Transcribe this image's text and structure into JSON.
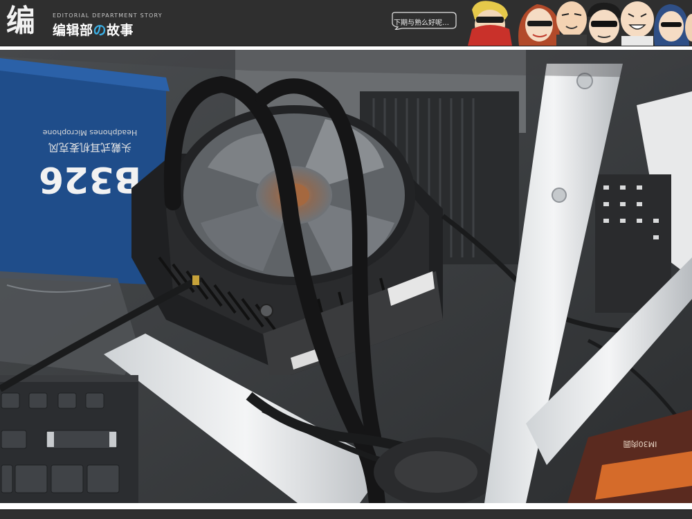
{
  "header": {
    "logo_mark": "编",
    "logo_subtitle": "EDITORIAL DEPARTMENT STORY",
    "logo_title_part1": "编辑部",
    "logo_title_accent": "の",
    "logo_title_part2": "故事",
    "speech_bubble": "下期与熟么好呢…",
    "avatars": [
      "bandit-avatar",
      "red-hair-girl-avatar",
      "bald-man-avatar",
      "sunglasses-man-avatar",
      "laughing-man-avatar",
      "blue-hair-girl-avatar",
      "partial-avatar"
    ]
  },
  "photo": {
    "box_label_model": "B326",
    "box_label_cn": "头戴式耳机麦克风",
    "box_label_en": "Headphones Microphone",
    "bottom_right_text": "IM30肉圆"
  },
  "colors": {
    "banner_bg": "#2f2f2f",
    "accent": "#3bb0e6",
    "box_blue": "#1f4d8a"
  }
}
